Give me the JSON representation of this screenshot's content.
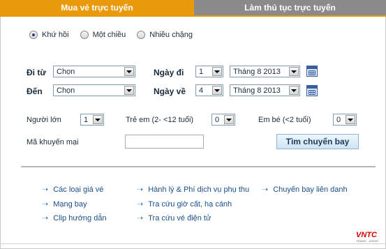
{
  "tabs": {
    "booking": "Mua vé trực tuyến",
    "checkin": "Làm thủ tục trực tuyến"
  },
  "trip_type": {
    "options": [
      "Khứ hồi",
      "Một chiều",
      "Nhiều chặng"
    ],
    "selected": "Khứ hồi"
  },
  "route": {
    "from_label": "Đi từ",
    "from_value": "Chọn",
    "to_label": "Đến",
    "to_value": "Chọn"
  },
  "dates": {
    "depart_label": "Ngày đi",
    "depart_day": "1",
    "depart_month": "Tháng 8 2013",
    "return_label": "Ngày về",
    "return_day": "4",
    "return_month": "Tháng 8 2013"
  },
  "passengers": {
    "adult_label": "Người lớn",
    "adult_value": "1",
    "child_label": "Trẻ em (2- <12 tuổi)",
    "child_value": "0",
    "infant_label": "Em bé (<2 tuổi)",
    "infant_value": "0"
  },
  "promo": {
    "label": "Mã khuyến mại",
    "value": ""
  },
  "search_button": "Tìm chuyến bay",
  "links": {
    "col1": [
      "Các loại giá vé",
      "Mạng bay",
      "Clip hướng dẫn"
    ],
    "col2": [
      "Hành lý & Phí dịch vụ phụ thu",
      "Tra cứu giờ cất, hạ cánh",
      "Tra cứu vé điện tử"
    ],
    "col3": [
      "Chuyến bay liên danh"
    ]
  },
  "logo": {
    "text": "VNTC",
    "subtext": "TRAVEL · AGENT"
  },
  "colors": {
    "tab_active": "#e89a0c",
    "tab_inactive": "#8a8a8a",
    "link": "#1a4e8a",
    "logo": "#d40000"
  }
}
